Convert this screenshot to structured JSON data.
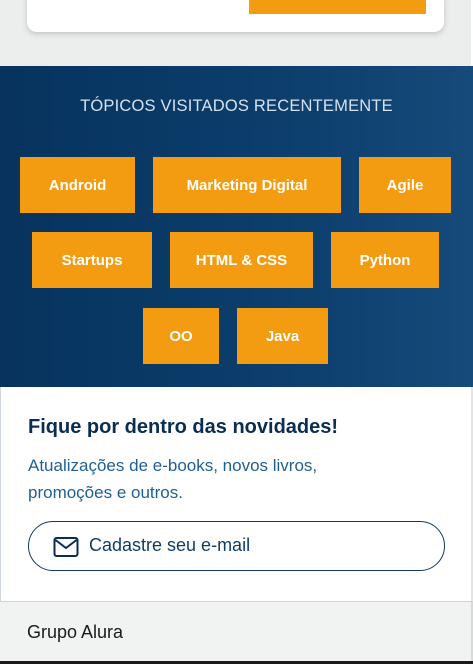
{
  "topics": {
    "title": "TÓPICOS VISITADOS RECENTEMENTE",
    "tags": [
      "Android",
      "Marketing Digital",
      "Agile",
      "Startups",
      "HTML & CSS",
      "Python",
      "OO",
      "Java"
    ]
  },
  "newsletter": {
    "title": "Fique por dentro das novidades!",
    "description": "Atualizações de e-books, novos livros, promoções e outros.",
    "email_placeholder": "Cadastre seu e-mail",
    "icon": "mail-icon"
  },
  "footer": {
    "label": "Grupo Alura"
  },
  "colors": {
    "accent": "#f39c12",
    "navy": "#0a2d52",
    "link_blue": "#1f5f94"
  }
}
